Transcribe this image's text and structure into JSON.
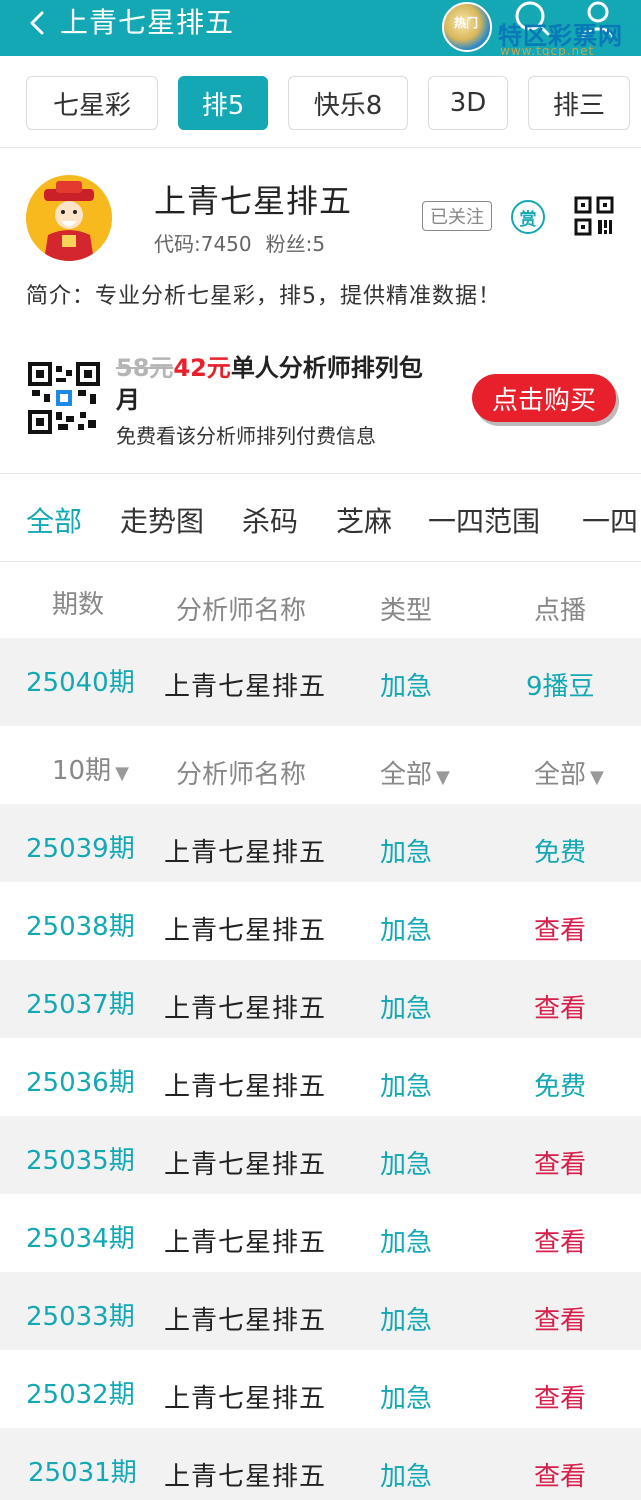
{
  "header": {
    "title": "上青七星排五",
    "watermark": "特区彩票网",
    "watermark_sub": "www.tqcp.net",
    "badge": "热门",
    "colors": {
      "accent": "#14a8b4",
      "highlight": "#e8202c",
      "view": "#d81e4a"
    }
  },
  "lottery_tabs": [
    {
      "label": "七星彩",
      "active": false
    },
    {
      "label": "排5",
      "active": true
    },
    {
      "label": "快乐8",
      "active": false
    },
    {
      "label": "3D",
      "active": false
    },
    {
      "label": "排三",
      "active": false
    }
  ],
  "profile": {
    "name": "上青七星排五",
    "code": "代码:7450",
    "fans": "粉丝:5",
    "follow_label": "已关注",
    "reward_label": "赏",
    "intro": "简介：专业分析七星彩，排5，提供精准数据！"
  },
  "promo": {
    "old_price": "58元",
    "new_price": "42元",
    "title": "单人分析师排列包月",
    "subtitle": "免费看该分析师排列付费信息",
    "buy_label": "点击购买"
  },
  "category_tabs": [
    {
      "label": "全部",
      "active": true
    },
    {
      "label": "走势图",
      "active": false
    },
    {
      "label": "杀码",
      "active": false
    },
    {
      "label": "芝麻",
      "active": false
    },
    {
      "label": "一四范围",
      "active": false
    },
    {
      "label": "一四",
      "active": false
    }
  ],
  "current_table": {
    "headers": [
      "期数",
      "分析师名称",
      "类型",
      "点播"
    ],
    "rows": [
      {
        "issue": "25040期",
        "name": "上青七星排五",
        "type": "加急",
        "play": "9播豆"
      }
    ]
  },
  "history_table": {
    "filters": {
      "periods": "10期",
      "name": "分析师名称",
      "type": "全部",
      "play": "全部"
    },
    "rows": [
      {
        "issue": "25039期",
        "name": "上青七星排五",
        "type": "加急",
        "play": "免费"
      },
      {
        "issue": "25038期",
        "name": "上青七星排五",
        "type": "加急",
        "play": "查看"
      },
      {
        "issue": "25037期",
        "name": "上青七星排五",
        "type": "加急",
        "play": "查看"
      },
      {
        "issue": "25036期",
        "name": "上青七星排五",
        "type": "加急",
        "play": "免费"
      },
      {
        "issue": "25035期",
        "name": "上青七星排五",
        "type": "加急",
        "play": "查看"
      },
      {
        "issue": "25034期",
        "name": "上青七星排五",
        "type": "加急",
        "play": "查看"
      },
      {
        "issue": "25033期",
        "name": "上青七星排五",
        "type": "加急",
        "play": "查看"
      },
      {
        "issue": "25032期",
        "name": "上青七星排五",
        "type": "加急",
        "play": "查看"
      },
      {
        "issue": "25031期",
        "name": "上青七星排五",
        "type": "加急",
        "play": "查看"
      }
    ]
  }
}
